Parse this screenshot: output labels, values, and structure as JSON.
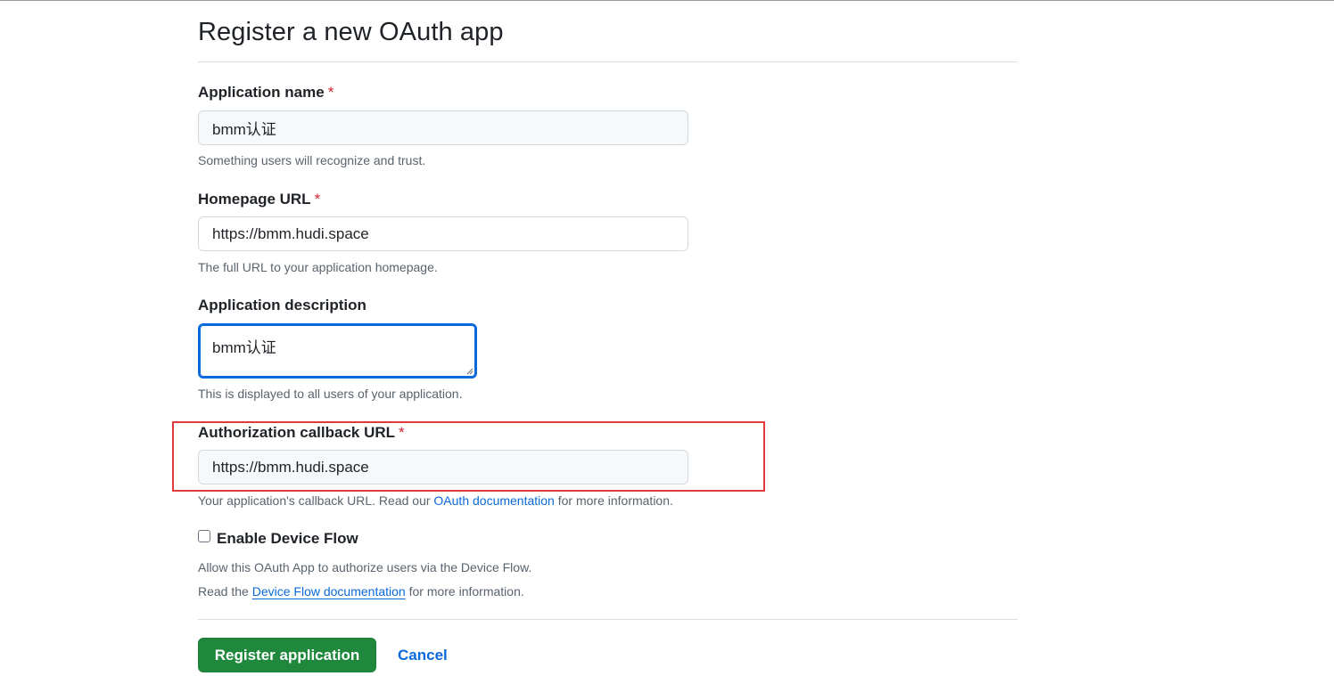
{
  "page": {
    "title": "Register a new OAuth app"
  },
  "fields": {
    "app_name": {
      "label": "Application name",
      "required_mark": "*",
      "value": "bmm认证",
      "hint": "Something users will recognize and trust."
    },
    "homepage_url": {
      "label": "Homepage URL",
      "required_mark": "*",
      "value": "https://bmm.hudi.space",
      "hint": "The full URL to your application homepage."
    },
    "description": {
      "label": "Application description",
      "value": "bmm认证",
      "hint": "This is displayed to all users of your application."
    },
    "callback_url": {
      "label": "Authorization callback URL",
      "required_mark": "*",
      "value": "https://bmm.hudi.space",
      "hint_before": "Your application's callback URL. Read our",
      "hint_link": "OAuth documentation",
      "hint_after": "for more information."
    }
  },
  "device_flow": {
    "label": "Enable Device Flow",
    "checked": false,
    "hint_line1": "Allow this OAuth App to authorize users via the Device Flow.",
    "hint_line2_before": "Read the",
    "hint_line2_link": "Device Flow documentation",
    "hint_line2_after": "for more information."
  },
  "actions": {
    "register_label": "Register application",
    "cancel_label": "Cancel"
  },
  "colors": {
    "primary_button": "#1f883d",
    "link": "#0969da",
    "required": "#cf222e",
    "focus_border": "#0969da",
    "highlight_annotation": "#e03a3a"
  },
  "icons": {
    "textarea_resize": "resize-grip-icon"
  }
}
